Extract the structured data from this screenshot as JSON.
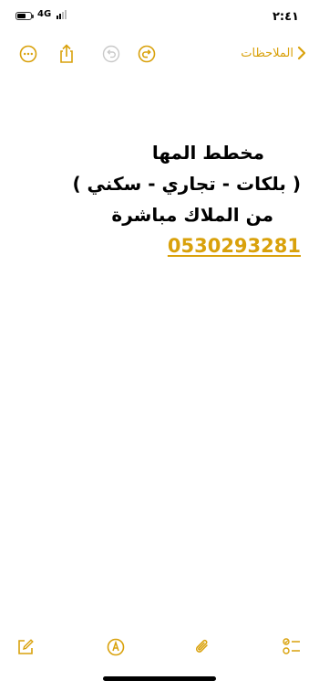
{
  "status_bar": {
    "time": "٢:٤١",
    "network": "4G"
  },
  "nav": {
    "back_label": "الملاحظات"
  },
  "note": {
    "lines": [
      "مخطط المها",
      "( بلكات - تجاري - سكني )",
      "من الملاك مباشرة"
    ],
    "phone": "0530293281"
  },
  "colors": {
    "accent": "#d9a10b"
  },
  "icons": {
    "nav": [
      "more-icon",
      "share-icon",
      "undo-icon",
      "redo-icon",
      "back-chevron-icon"
    ],
    "toolbar": [
      "compose-icon",
      "markup-pen-icon",
      "attachment-icon",
      "checklist-icon"
    ]
  }
}
